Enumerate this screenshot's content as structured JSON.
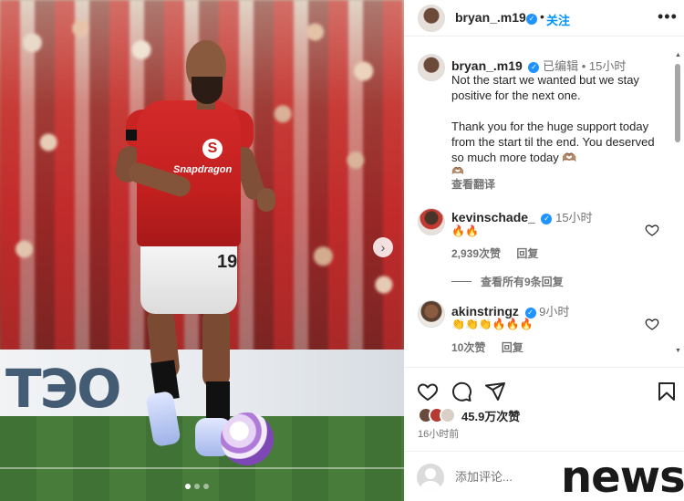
{
  "post": {
    "username": "bryan_.m19",
    "follow_label": "关注",
    "more_label": "•••",
    "caption_edited": "已编辑",
    "caption_time": "15小时",
    "caption_paragraph_1": "Not the start we wanted but we stay positive for the next one.",
    "caption_paragraph_2": "Thank you for the huge support today from the start til the end. You deserved so much more today 🫶🏽",
    "caption_emoji_line": "🫶🏽",
    "see_translation": "查看翻译"
  },
  "photo": {
    "board_text": "TЭO",
    "sponsor_text": "Snapdragon",
    "shirt_number": "19"
  },
  "comments": [
    {
      "username": "kevinschade_",
      "time": "15小时",
      "text": "🔥🔥",
      "likes": "2,939次赞",
      "reply_label": "回复",
      "view_replies": "查看所有9条回复"
    },
    {
      "username": "akinstringz",
      "time": "9小时",
      "text": "👏👏👏🔥🔥🔥",
      "likes": "10次赞",
      "reply_label": "回复"
    }
  ],
  "engagement": {
    "likes_count": "45.9万次赞",
    "posted_ago": "16小时前"
  },
  "comment_box": {
    "placeholder": "添加评论..."
  },
  "watermark": "news",
  "colors": {
    "link_blue": "#0095f6",
    "verified_blue": "#1f93ff",
    "secondary_text": "#737373",
    "primary_text": "#262626"
  },
  "icons": [
    "verified-badge-icon",
    "more-icon",
    "chevron-right-icon",
    "heart-icon",
    "comment-icon",
    "share-icon",
    "bookmark-icon",
    "user-placeholder-icon"
  ]
}
